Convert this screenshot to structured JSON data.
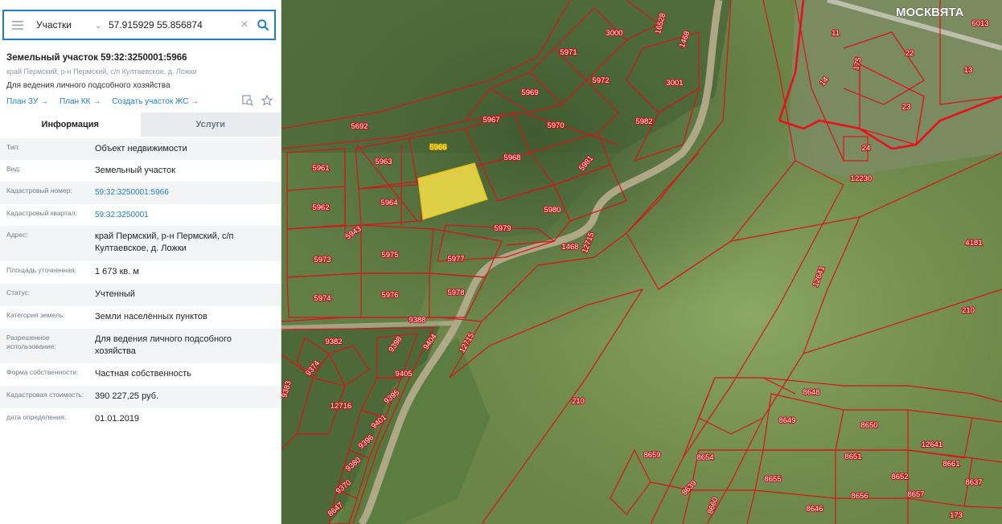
{
  "search": {
    "layer": "Участки",
    "query": "57.915929 55.856874"
  },
  "parcel": {
    "title": "Земельный участок 59:32:3250001:5966",
    "address_short": "край Пермский, р-н Пермский, с/п Култаевское, д. Ложки",
    "purpose": "Для ведения личного подсобного хозяйства",
    "links": [
      "План ЗУ →",
      "План КК →",
      "Создать участок ЖС →"
    ]
  },
  "tabs": [
    "Информация",
    "Услуги"
  ],
  "info_rows": [
    {
      "label": "Тип:",
      "value": "Объект недвижимости",
      "link": false
    },
    {
      "label": "Вид:",
      "value": "Земельный участок",
      "link": false
    },
    {
      "label": "Кадастровый номер:",
      "value": "59:32:3250001:5966",
      "link": true
    },
    {
      "label": "Кадастровый квартал:",
      "value": "59:32:3250001",
      "link": true
    },
    {
      "label": "Адрес:",
      "value": "край Пермский, р-н Пермский, с/п Култаевское, д. Ложки",
      "link": false
    },
    {
      "label": "Площадь уточненная:",
      "value": "1 673 кв. м",
      "link": false
    },
    {
      "label": "Статус:",
      "value": "Учтенный",
      "link": false
    },
    {
      "label": "Категория земель:",
      "value": "Земли населённых пунктов",
      "link": false
    },
    {
      "label": "Разрешенное использование:",
      "value": "Для ведения личного подсобного хозяйства",
      "link": false
    },
    {
      "label": "Форма собственности:",
      "value": "Частная собственность",
      "link": false
    },
    {
      "label": "Кадастровая стоимость:",
      "value": "390 227,25 руб.",
      "link": false
    },
    {
      "label": "дата определения:",
      "value": "01.01.2019",
      "link": false
    }
  ],
  "map": {
    "place_name": "МОСКВЯТА",
    "selected_parcel": "5966",
    "parcel_labels": [
      "3000",
      "5971",
      "5972",
      "3001",
      "5969",
      "5967",
      "5970",
      "5982",
      "5692",
      "5966",
      "5963",
      "5968",
      "5981",
      "5961",
      "5964",
      "5980",
      "5962",
      "5979",
      "5973",
      "5975",
      "5977",
      "5943",
      "12715",
      "1468",
      "12641",
      "4181",
      "5974",
      "5976",
      "5978",
      "210",
      "9388",
      "9382",
      "9398",
      "9404",
      "12715",
      "9374",
      "9405",
      "9383",
      "9395",
      "12716",
      "9401",
      "9396",
      "9380",
      "9370",
      "8647",
      "8648",
      "8649",
      "8650",
      "12641",
      "8659",
      "8654",
      "8651",
      "8661",
      "8639",
      "8660",
      "8655",
      "8652",
      "8637",
      "8646",
      "8656",
      "8657",
      "173",
      "11",
      "22",
      "13",
      "23",
      "24",
      "12230",
      "175",
      "14",
      "6013",
      "16528",
      "1468",
      "210"
    ],
    "colors": {
      "boundary": "#d7141a",
      "selected_fill": "#ffe94a",
      "forest": "#4f6b3c",
      "field": "#7f9a5a"
    }
  }
}
